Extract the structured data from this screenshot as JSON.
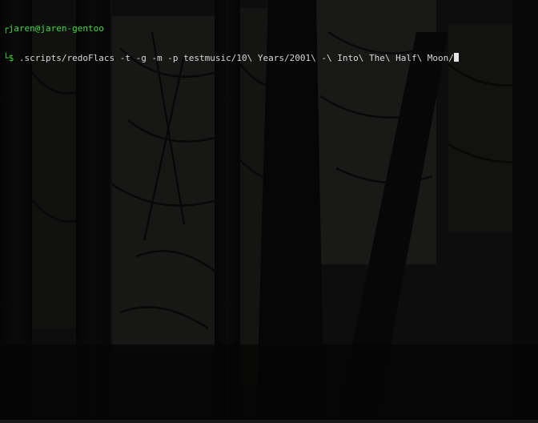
{
  "terminal": {
    "user_host": "jaren@jaren-gentoo",
    "prompt_box_top": "┌",
    "prompt_box_bottom": "└",
    "prompt_symbol": "$",
    "command": ".scripts/redoFlacs -t -g -m -p testmusic/10\\ Years/2001\\ -\\ Into\\ The\\ Half\\ Moon/"
  },
  "colors": {
    "prompt_green": "#3fdc3f",
    "text": "#d8d8d8",
    "background": "#050505"
  },
  "icons": {
    "cursor": "block-cursor"
  }
}
